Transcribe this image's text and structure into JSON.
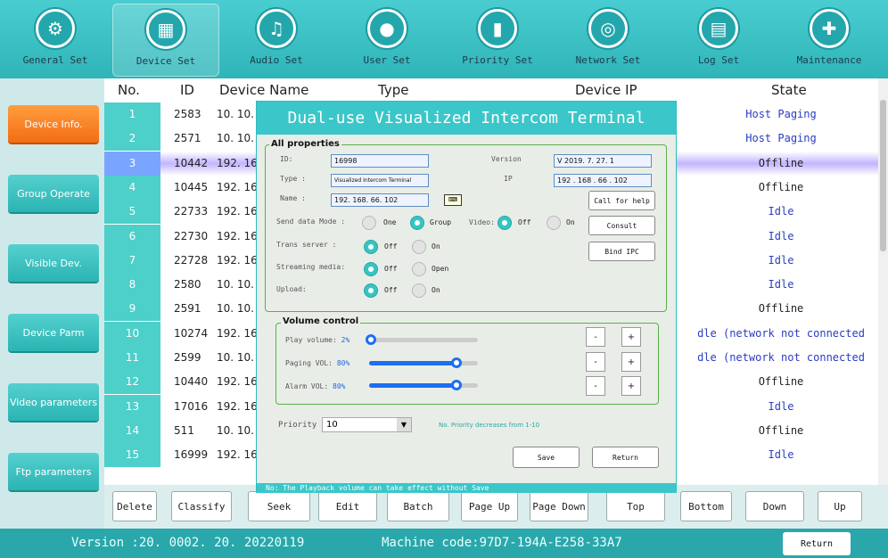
{
  "topbar": {
    "items": [
      {
        "label": "General Set",
        "icon": "gear-icon",
        "active": false
      },
      {
        "label": "Device Set",
        "icon": "grid-icon",
        "active": true
      },
      {
        "label": "Audio Set",
        "icon": "music-icon",
        "active": false
      },
      {
        "label": "User Set",
        "icon": "user-icon",
        "active": false
      },
      {
        "label": "Priority Set",
        "icon": "bars-icon",
        "active": false
      },
      {
        "label": "Network Set",
        "icon": "globe-icon",
        "active": false
      },
      {
        "label": "Log Set",
        "icon": "calendar-icon",
        "active": false
      },
      {
        "label": "Maintenance",
        "icon": "shield-icon",
        "active": false
      }
    ]
  },
  "sidebar": {
    "items": [
      {
        "label": "Device Info.",
        "active": true
      },
      {
        "label": "Group Operate",
        "active": false
      },
      {
        "label": "Visible Dev.",
        "active": false
      },
      {
        "label": "Device Parm",
        "active": false
      },
      {
        "label": "Video parameters",
        "active": false
      },
      {
        "label": "Ftp parameters",
        "active": false
      }
    ]
  },
  "table": {
    "headers": {
      "no": "No.",
      "id": "ID",
      "name": "Device Name",
      "type": "Type",
      "ip": "Device IP",
      "state": "State"
    },
    "rows": [
      {
        "no": "1",
        "id": "2583",
        "ip": "10. 10.",
        "state": "Host Paging",
        "state_color": "#2a3cc2"
      },
      {
        "no": "2",
        "id": "2571",
        "ip": "10. 10.",
        "state": "Host Paging",
        "state_color": "#2a3cc2"
      },
      {
        "no": "3",
        "id": "10442",
        "ip": "192. 16",
        "state": "Offline",
        "state_color": "#222222",
        "selected": true
      },
      {
        "no": "4",
        "id": "10445",
        "ip": "192. 16",
        "state": "Offline",
        "state_color": "#222222"
      },
      {
        "no": "5",
        "id": "22733",
        "ip": "192. 16",
        "state": "Idle",
        "state_color": "#2a3cc2"
      },
      {
        "no": "6",
        "id": "22730",
        "ip": "192. 16",
        "state": "Idle",
        "state_color": "#2a3cc2"
      },
      {
        "no": "7",
        "id": "22728",
        "ip": "192. 16",
        "state": "Idle",
        "state_color": "#2a3cc2"
      },
      {
        "no": "8",
        "id": "2580",
        "ip": "10. 10.",
        "state": "Idle",
        "state_color": "#2a3cc2"
      },
      {
        "no": "9",
        "id": "2591",
        "ip": "10. 10.",
        "state": "Offline",
        "state_color": "#222222"
      },
      {
        "no": "10",
        "id": "10274",
        "ip": "192. 16",
        "state": "dle (network not connected",
        "state_color": "#2a3cc2"
      },
      {
        "no": "11",
        "id": "2599",
        "ip": "10. 10.",
        "state": "dle (network not connected",
        "state_color": "#2a3cc2"
      },
      {
        "no": "12",
        "id": "10440",
        "ip": "192. 16",
        "state": "Offline",
        "state_color": "#222222"
      },
      {
        "no": "13",
        "id": "17016",
        "ip": "192. 16",
        "state": "Idle",
        "state_color": "#2a3cc2"
      },
      {
        "no": "14",
        "id": "511",
        "ip": "10. 10.",
        "state": "Offline",
        "state_color": "#222222"
      },
      {
        "no": "15",
        "id": "16999",
        "ip": "192. 16",
        "state": "Idle",
        "state_color": "#2a3cc2"
      }
    ]
  },
  "bottombar": {
    "buttons": [
      "Delete",
      "Classify",
      "Seek",
      "Edit",
      "Batch",
      "Page Up",
      "Page Down",
      "Top",
      "Bottom",
      "Down",
      "Up"
    ]
  },
  "footer": {
    "version": "Version :20. 0002. 20. 20220119",
    "machine": "Machine code:97D7-194A-E258-33A7",
    "return": "Return"
  },
  "dialog": {
    "title": "Dual-use Visualized Intercom Terminal",
    "props_title": "All properties",
    "id_label": "ID:",
    "id_value": "16998",
    "version_label": "Version",
    "version_value": "V 2019. 7. 27. 1",
    "type_label": "Type :",
    "type_value": "Visualized Intercom Terminal",
    "ip_label": "IP",
    "ip_value": "192 . 168 . 66 . 102",
    "name_label": "Name :",
    "name_value": "192. 168. 66. 102",
    "call_for_help": "Call for help",
    "consult": "Consult",
    "bind_ipc": "Bind IPC",
    "send_mode_label": "Send data Mode :",
    "send_one": "One",
    "send_group": "Group",
    "send_mode": "Group",
    "video_label": "Video:",
    "video_off": "Off",
    "video_on": "On",
    "video": "Off",
    "trans_label": "Trans server :",
    "trans_off": "Off",
    "trans_on": "On",
    "trans": "Off",
    "stream_label": "Streaming media:",
    "stream_off": "Off",
    "stream_open": "Open",
    "stream": "Off",
    "upload_label": "Upload:",
    "upload_off": "Off",
    "upload_on": "On",
    "upload": "Off",
    "volume_title": "Volume control",
    "play_label": "Play volume:",
    "play_value": "2%",
    "play_level": 0.02,
    "paging_label": "Paging VOL:",
    "paging_value": "80%",
    "paging_level": 0.8,
    "alarm_label": "Alarm VOL:",
    "alarm_value": "80%",
    "alarm_level": 0.8,
    "minus": "-",
    "plus": "+",
    "priority_label": "Priority",
    "priority_value": "10",
    "priority_hint": "No. Priority decreases from 1-10",
    "save": "Save",
    "return": "Return",
    "note": "No: The Playback volume can take effect without Save"
  },
  "colors": {
    "accent": "#3bc6c9",
    "selected_row": "#c4b4ff",
    "active_tab": "#f36d13",
    "slider": "#1c6ef2"
  }
}
